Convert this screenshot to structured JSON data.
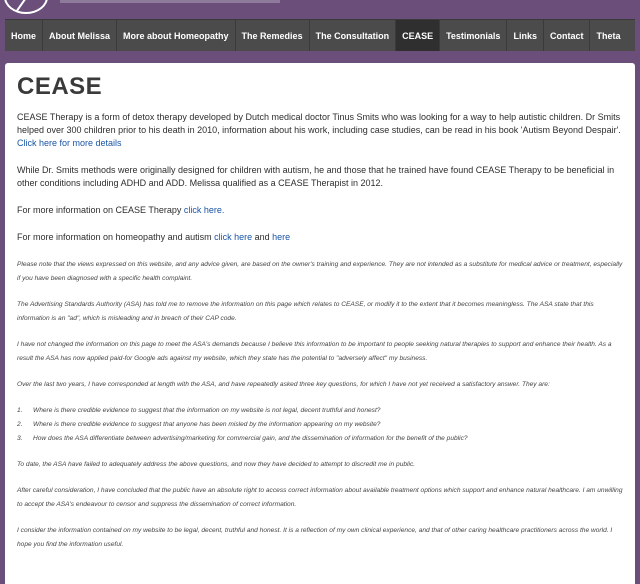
{
  "nav": {
    "items": [
      {
        "label": "Home"
      },
      {
        "label": "About Melissa"
      },
      {
        "label": "More about Homeopathy"
      },
      {
        "label": "The Remedies"
      },
      {
        "label": "The Consultation"
      },
      {
        "label": "CEASE"
      },
      {
        "label": "Testimonials"
      },
      {
        "label": "Links"
      },
      {
        "label": "Contact"
      },
      {
        "label": "Theta"
      }
    ],
    "active": "CEASE"
  },
  "page": {
    "title": "CEASE",
    "p1_text": "CEASE Therapy is a form of detox therapy developed by Dutch medical doctor Tinus Smits who was looking for a way to help autistic children. Dr Smits helped over 300 children prior to his death in 2010, information about his work, including case studies, can be read in his book 'Autism Beyond Despair'. ",
    "p1_link": "Click here for more details",
    "p2_text": "While Dr. Smits methods were originally designed for children with autism, he and those that he trained have found CEASE Therapy to be beneficial in other conditions including ADHD and ADD. Melissa qualified as a CEASE Therapist in 2012.",
    "p3_text": "For more information on CEASE Therapy ",
    "p3_link": "click here.",
    "p4_text": "For more information on homeopathy and autism ",
    "p4_link1": "click here",
    "p4_and": " and ",
    "p4_link2": "here",
    "note1": "Please note that the views expressed on this website, and any advice given, are based on the owner's training and experience. They are not intended as a substitute for medical advice or treatment, especially if you have been diagnosed with a specific health complaint.",
    "note2": "The Advertising Standards Authority (ASA) has told me to remove the information on this page which relates to CEASE, or modify it to the extent that it becomes meaningless. The ASA state that this information is an \"ad\", which is misleading and in breach of their CAP code.",
    "note3": "I have not changed the information on this page to meet the ASA's demands because I believe this information to be important to people seeking natural therapies to support and enhance their health. As a result the ASA has now applied paid-for Google ads against my website, which they state has the potential to \"adversely affect\" my business.",
    "note4": "Over the last two years, I have corresponded at length with the ASA, and have repeatedly asked three key questions, for which I have not yet received a satisfactory answer. They are:",
    "questions": [
      {
        "num": "1.",
        "text": "Where is there credible evidence to suggest that the information on my website is not legal, decent truthful and honest?"
      },
      {
        "num": "2.",
        "text": "Where is there credible evidence to suggest that anyone has been misled by the information appearing on my website?"
      },
      {
        "num": "3.",
        "text": "How does the ASA differentiate between advertising/marketing for commercial gain, and the dissemination of information for the benefit of the public?"
      }
    ],
    "note5": "To date, the ASA have failed to adequately address the above questions, and now they have decided to attempt to discredit me in public.",
    "note6": "After careful consideration, I have concluded that the public have an absolute right to access correct information about available treatment options which support and enhance natural healthcare. I am unwilling to accept the ASA's endeavour to censor and suppress the dissemination of correct information.",
    "note7": "I consider the information contained on my website to be legal, decent, truthful and honest. It is a reflection of my own clinical experience, and that of other caring healthcare practitioners across the world. I hope you find the information useful."
  },
  "colors": {
    "background": "#6b4f7a",
    "nav_bg": "#4b4b4b",
    "nav_active": "#2f2f2f",
    "link": "#1a55a6"
  }
}
